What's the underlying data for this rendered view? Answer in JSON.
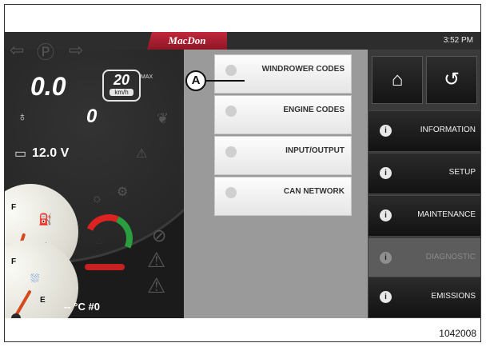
{
  "brand": "MacDon",
  "clock": "3:52 PM",
  "cluster": {
    "speed": "0.0",
    "speed_limit": "20",
    "speed_unit": "km/h",
    "speed_limit_label": "MAX",
    "rpm": "0",
    "voltage": "12.0 V",
    "fuel_full": "F",
    "fuel_empty": "E",
    "def_full": "F",
    "def_empty": "E",
    "bottom_readout": "-- °C   #0"
  },
  "menu": {
    "items": [
      {
        "label": "WINDROWER CODES"
      },
      {
        "label": "ENGINE CODES"
      },
      {
        "label": "INPUT/OUTPUT"
      },
      {
        "label": "CAN NETWORK"
      }
    ]
  },
  "side_nav": {
    "items": [
      {
        "label": "INFORMATION"
      },
      {
        "label": "SETUP"
      },
      {
        "label": "MAINTENANCE"
      },
      {
        "label": "DIAGNOSTIC"
      },
      {
        "label": "EMISSIONS"
      }
    ]
  },
  "callout": "A",
  "figure_number": "1042008",
  "colors": {
    "brand": "#a61c2e",
    "needle": "#d44a1e",
    "temp_hot": "#d22222",
    "temp_ok": "#2a9d3f"
  }
}
